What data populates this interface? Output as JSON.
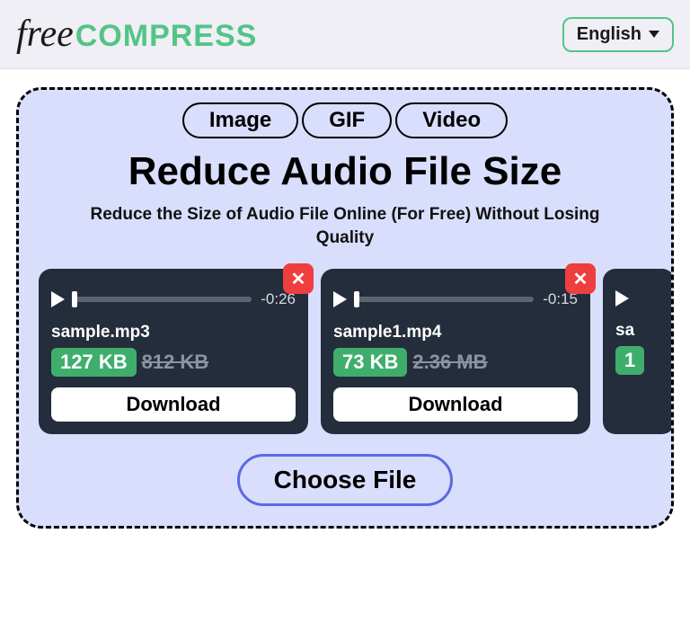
{
  "header": {
    "logo_script": "free",
    "logo_bold": "COMPRESS",
    "language": "English"
  },
  "tabs": [
    "Image",
    "GIF",
    "Video"
  ],
  "title": "Reduce Audio File Size",
  "subtitle": "Reduce the Size of Audio File Online (For Free) Without Losing Quality",
  "cards": [
    {
      "time": "-0:26",
      "filename": "sample.mp3",
      "new_size": "127 KB",
      "old_size": "812 KB",
      "download": "Download"
    },
    {
      "time": "-0:15",
      "filename": "sample1.mp4",
      "new_size": "73 KB",
      "old_size": "2.36 MB",
      "download": "Download"
    },
    {
      "time": "",
      "filename": "sa",
      "new_size": "1",
      "old_size": "",
      "download": ""
    }
  ],
  "choose_file": "Choose File"
}
